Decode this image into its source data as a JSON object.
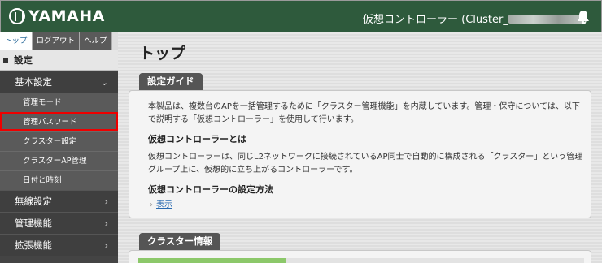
{
  "header": {
    "logo_text": "YAMAHA",
    "cluster_label": "仮想コントローラー (Cluster_",
    "cluster_label_end": ")",
    "bell_icon": "bell-icon"
  },
  "sidebar": {
    "tabs": [
      {
        "label": "トップ"
      },
      {
        "label": "ログアウト"
      },
      {
        "label": "ヘルプ"
      }
    ],
    "section": "設定",
    "groups": [
      {
        "label": "基本設定",
        "expanded": true
      },
      {
        "label": "無線設定",
        "expanded": false
      },
      {
        "label": "管理機能",
        "expanded": false
      },
      {
        "label": "拡張機能",
        "expanded": false
      }
    ],
    "items": [
      {
        "label": "管理モード"
      },
      {
        "label": "管理パスワード",
        "highlighted": true
      },
      {
        "label": "クラスター設定"
      },
      {
        "label": "クラスターAP管理"
      },
      {
        "label": "日付と時刻"
      }
    ],
    "highlight_color": "#e00000"
  },
  "main": {
    "title": "トップ",
    "guide": {
      "tab": "設定ガイド",
      "line1": "本製品は、複数台のAPを一括管理するために「クラスター管理機能」を内蔵しています。管理・保守については、以下",
      "line2": "で説明する「仮想コントローラー」を使用して行います。",
      "heading1": "仮想コントローラーとは",
      "desc1": "仮想コントローラーは、同じL2ネットワークに接続されているAP同士で自動的に構成される「クラスター」という管理",
      "desc2": "グループ上に、仮想的に立ち上がるコントローラーです。",
      "heading2": "仮想コントローラーの設定方法",
      "link": "表示"
    },
    "cluster": {
      "tab": "クラスター情報",
      "progress_fraction": 0.33,
      "progress_color": "#8cc86a"
    }
  },
  "colors": {
    "header_bg": "#2e5a3c",
    "sidebar_bg": "#444444",
    "panel_tab_bg": "#555555"
  }
}
